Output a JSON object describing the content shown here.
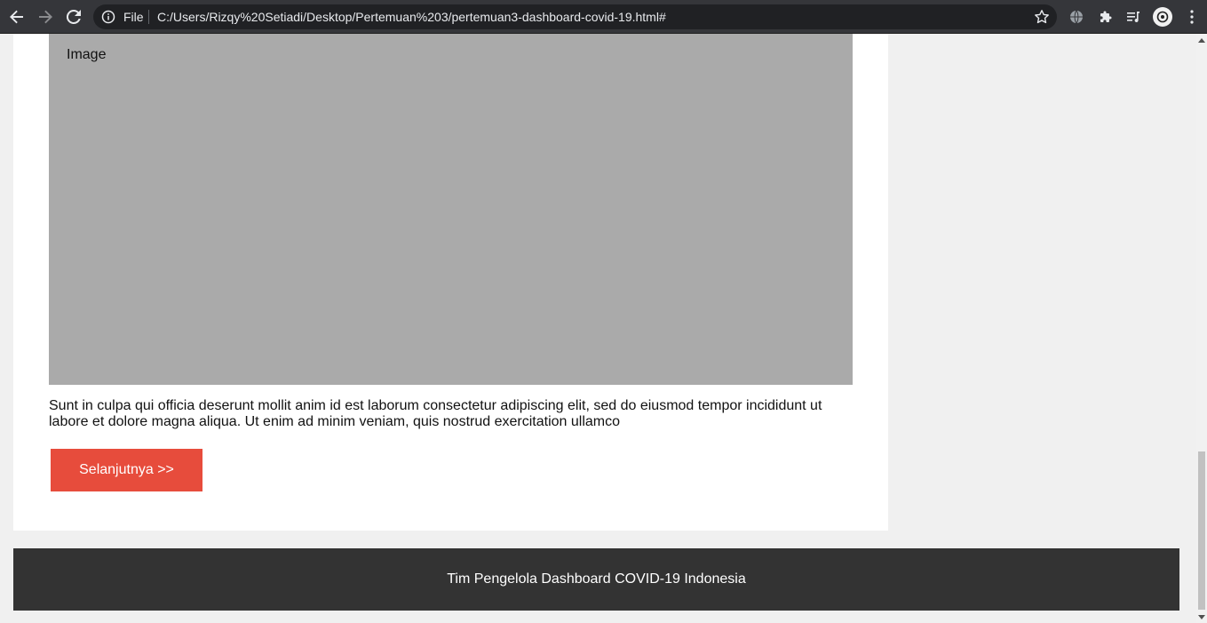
{
  "browser": {
    "scheme_label": "File",
    "url": "C:/Users/Rizqy%20Setiadi/Desktop/Pertemuan%203/pertemuan3-dashboard-covid-19.html#"
  },
  "article": {
    "image_label": "Image",
    "description": "Sunt in culpa qui officia deserunt mollit anim id est laborum consectetur adipiscing elit, sed do eiusmod tempor incididunt ut labore et dolore magna aliqua. Ut enim ad minim veniam, quis nostrud exercitation ullamco",
    "next_button": "Selanjutnya >>"
  },
  "footer": {
    "text": "Tim Pengelola Dashboard COVID-19 Indonesia"
  },
  "colors": {
    "accent_button": "#e74c3c",
    "footer_bg": "#333333",
    "image_placeholder": "#aaaaaa"
  }
}
